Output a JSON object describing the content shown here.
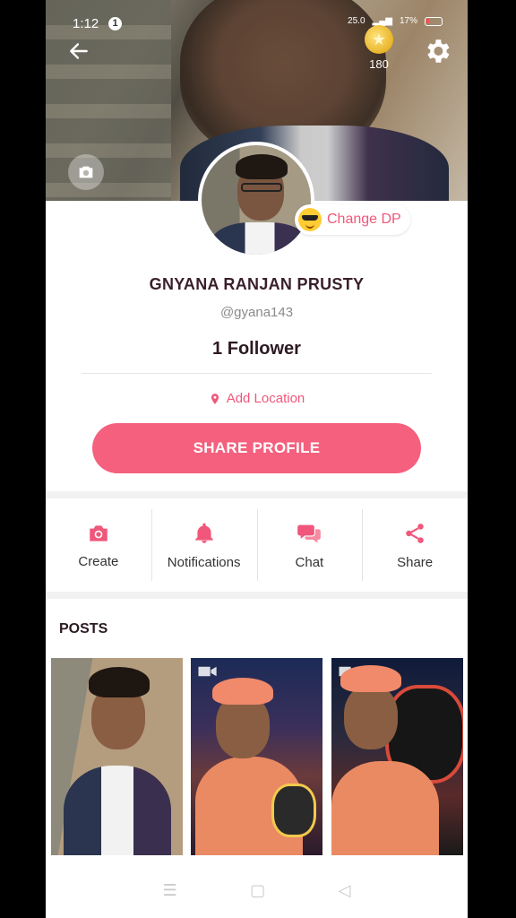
{
  "status_bar": {
    "time": "1:12",
    "notification_count": "1",
    "network_speed": "25.0",
    "battery": "17%"
  },
  "header": {
    "coins": "180"
  },
  "profile": {
    "change_dp_label": "Change DP",
    "name": "GNYANA RANJAN PRUSTY",
    "handle": "@gyana143",
    "followers": "1 Follower",
    "location_label": "Add Location",
    "share_button": "SHARE PROFILE"
  },
  "actions": [
    {
      "label": "Create",
      "icon": "camera-icon"
    },
    {
      "label": "Notifications",
      "icon": "bell-icon"
    },
    {
      "label": "Chat",
      "icon": "chat-bubbles-icon"
    },
    {
      "label": "Share",
      "icon": "share-icon"
    }
  ],
  "posts": {
    "title": "POSTS",
    "items": [
      {
        "type": "photo"
      },
      {
        "type": "video"
      },
      {
        "type": "video"
      }
    ]
  },
  "colors": {
    "accent": "#f4607e",
    "accent_text": "#f0577a",
    "heading": "#3a1f2b"
  }
}
